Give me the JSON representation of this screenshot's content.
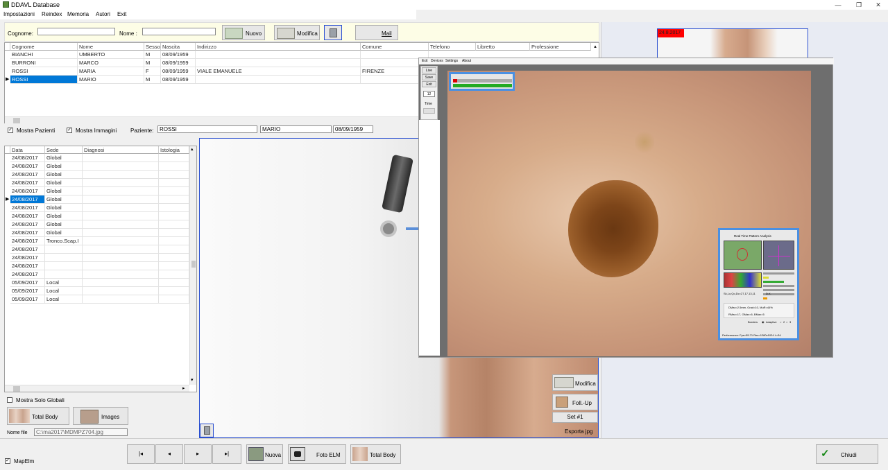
{
  "app": {
    "title": "DDAVL Database",
    "window_controls": {
      "minimize": "—",
      "restore": "❐",
      "close": "✕"
    }
  },
  "menu": [
    "Impostazioni",
    "Reindex",
    "Memoria",
    "Autori",
    "Exit"
  ],
  "search": {
    "cognome_label": "Cognome:",
    "nome_label": "Nome :",
    "cognome_value": "",
    "nome_value": "",
    "nuovo": "Nuovo",
    "modifica": "Modifica",
    "mail": "Mail"
  },
  "patients": {
    "columns": [
      "Cognome",
      "Nome",
      "Sesso",
      "Nascita",
      "Indirizzo",
      "Comune",
      "Telefono",
      "Libretto",
      "Professione"
    ],
    "rows": [
      [
        "BIANCHI",
        "UMBERTO",
        "M",
        "08/09/1959",
        "",
        "",
        "",
        "",
        ""
      ],
      [
        "BURRONI",
        "MARCO",
        "M",
        "08/09/1959",
        "",
        "",
        "",
        "",
        ""
      ],
      [
        "ROSSI",
        "MARIA",
        "F",
        "08/09/1959",
        "VIALE EMANUELE",
        "FIRENZE",
        "",
        "",
        ""
      ],
      [
        "ROSSI",
        "MARIO",
        "M",
        "08/09/1959",
        "",
        "",
        "",
        "",
        ""
      ]
    ],
    "selected_row": 3
  },
  "options": {
    "mostra_pazienti": "Mostra Pazienti",
    "mostra_immagini": "Mostra Immagini",
    "paziente_label": "Paziente:",
    "paziente_cognome": "ROSSI",
    "paziente_nome": "MARIO",
    "paziente_nascita": "08/09/1959"
  },
  "visits": {
    "columns": [
      "Data",
      "Sede",
      "Diagnosi",
      "Istologia"
    ],
    "rows": [
      [
        "24/08/2017",
        "Global",
        "",
        ""
      ],
      [
        "24/08/2017",
        "Global",
        "",
        ""
      ],
      [
        "24/08/2017",
        "Global",
        "",
        ""
      ],
      [
        "24/08/2017",
        "Global",
        "",
        ""
      ],
      [
        "24/08/2017",
        "Global",
        "",
        ""
      ],
      [
        "24/08/2017",
        "Global",
        "",
        ""
      ],
      [
        "24/08/2017",
        "Global",
        "",
        ""
      ],
      [
        "24/08/2017",
        "Global",
        "",
        ""
      ],
      [
        "24/08/2017",
        "Global",
        "",
        ""
      ],
      [
        "24/08/2017",
        "Global",
        "",
        ""
      ],
      [
        "24/08/2017",
        "Tronco.Scap.I",
        "",
        ""
      ],
      [
        "24/08/2017",
        "",
        "",
        ""
      ],
      [
        "24/08/2017",
        "",
        "",
        ""
      ],
      [
        "24/08/2017",
        "",
        "",
        ""
      ],
      [
        "24/08/2017",
        "",
        "",
        ""
      ],
      [
        "05/09/2017",
        "Local",
        "",
        ""
      ],
      [
        "05/09/2017",
        "Local",
        "",
        ""
      ],
      [
        "05/09/2017",
        "Local",
        "",
        ""
      ]
    ],
    "selected_row": 5
  },
  "left_bottom": {
    "mostra_solo_globali": "Mostra Solo Globali",
    "total_body": "Total Body",
    "images": "Images",
    "nome_file_label": "Nome file",
    "nome_file_value": "C:\\ma2017\\MDMPZ704.jpg"
  },
  "image_side": {
    "modifica": "Modifica",
    "follow_up": "Foll.-Up",
    "set": "Set #1",
    "esporta": "Esporta jpg"
  },
  "thumbnail": {
    "label": "24.8.2017"
  },
  "footer": {
    "first": "|◂",
    "prev": "◂",
    "next": "▸",
    "last": "▸|",
    "nuova": "Nuova",
    "foto_elm": "Foto ELM",
    "total_body": "Total Body",
    "chiudi": "Chiudi",
    "mapelm": "MapElm"
  },
  "dermo": {
    "menu": [
      "Exit",
      "Devices",
      "Settings",
      "About"
    ],
    "side_buttons": [
      "Live",
      "Save",
      "Exit"
    ],
    "counter": "12",
    "time_label": "Time",
    "analysis": {
      "title": "Real Time Pattern Analysis",
      "code": "Sk,Lo,Qo,Dc=27,17,13,11",
      "dk": "D.K.",
      "line1": "DMax=2.5mm, Grad=10, MuR=44%",
      "line2": "RMax=17, GMax=6, BMax=5",
      "borders_label": "Borders",
      "adaptive_label": "Adaptive",
      "opt2": "2",
      "opt3": "3",
      "perf": "Performance: Fps=55.71 Res=1280x1024 L=34"
    }
  },
  "colors": {
    "selection": "#0078d7",
    "form_bg": "#fdfde6",
    "frame_blue": "#2a4fd0",
    "arrow": "#5b8fd9",
    "thumb_label_bg": "#ff0000"
  }
}
